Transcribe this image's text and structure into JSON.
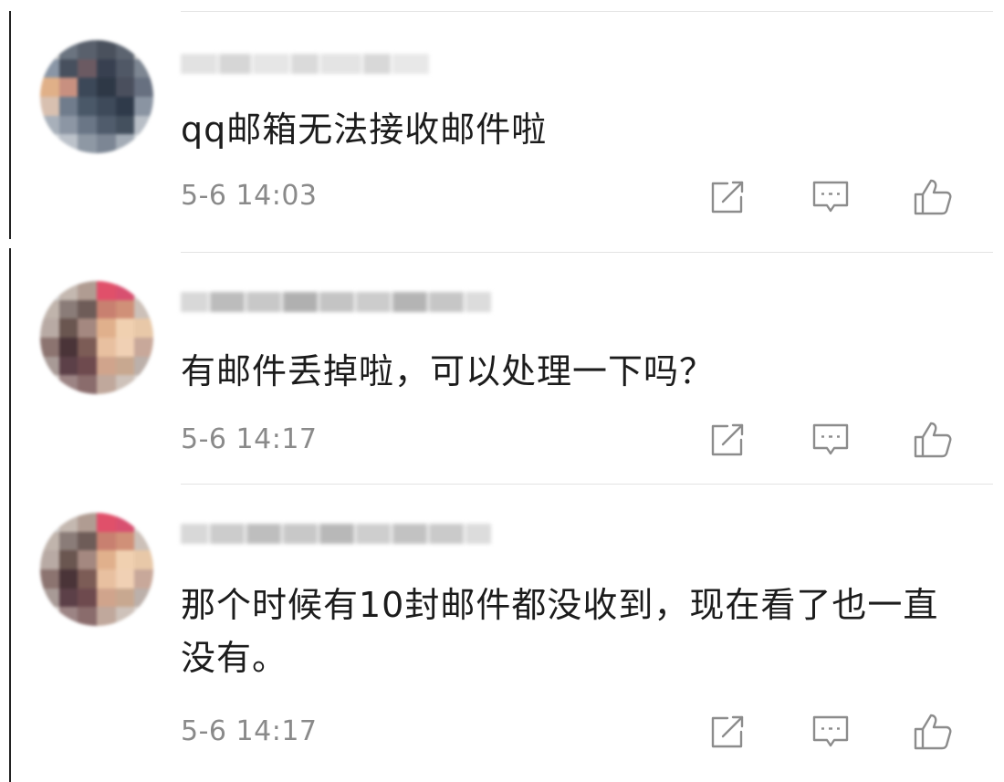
{
  "colors": {
    "text": "#1c1c1c",
    "time": "#8a8a8a",
    "icon": "#8c8c8c",
    "divider": "#e3e3e3"
  },
  "comments": [
    {
      "text": "qq邮箱无法接收邮件啦",
      "time": "5-6 14:03",
      "icons": [
        "share-icon",
        "reply-icon",
        "like-icon"
      ]
    },
    {
      "text": "有邮件丢掉啦，可以处理一下吗？",
      "time": "5-6 14:17",
      "icons": [
        "share-icon",
        "reply-icon",
        "like-icon"
      ]
    },
    {
      "text": "那个时候有10封邮件都没收到，现在看了也一直没有。",
      "time": "5-6 14:17",
      "icons": [
        "share-icon",
        "reply-icon",
        "like-icon"
      ]
    }
  ]
}
